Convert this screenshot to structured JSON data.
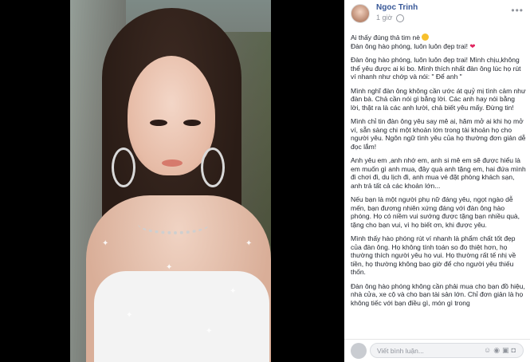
{
  "author": {
    "name": "Ngoc Trinh",
    "meta": "1 giờ"
  },
  "post": {
    "line1": "Ai thấy đúng thả tim nè",
    "line2": "Đàn ông hào phóng, luôn luôn đẹp trai!",
    "paragraphs": [
      "Đàn ông hào phóng, luôn luôn đẹp trai! Mình chịu,không thể yêu được ai ki bo. Mình thích nhất đàn ông lúc họ rút ví nhanh như chớp và nói: \" Để anh \"",
      "Mình nghĩ đàn ông không cần ước át quỷ mị tình cảm như đàn bà. Chả cần nói gì bằng lời. Các anh hay nói bằng lời, thật ra là các anh lười, chả biết yêu mấy. Đừng tin!",
      "Mình chỉ tin đàn ông yêu say mê ai, hăm mở ai khi họ mở ví, sẵn sàng chi một khoản lớn trong tài khoản họ cho người yêu. Ngôn ngữ tình yêu của họ thường đơn giản dễ đọc lắm!",
      "Anh yêu em ,anh nhớ em, anh si mê em sẽ được hiểu là em muốn gì anh mua, đây quà anh tặng em, hai đứa mình đi chơi đi, du lịch đi, anh mua vé đặt phòng khách sạn, anh trả tất cả các khoản lớn...",
      "Nếu bạn là một người phụ nữ đáng yêu, ngọt ngào dễ mến, bạn đương nhiên xứng đáng với đàn ông hào phóng. Họ có niềm vui sướng được tặng bạn nhiều quà, tặng cho bạn vui, vì họ biết ơn, khi được yêu.",
      "Mình thấy hào phóng rút ví nhanh là phẩm chất tốt đẹp của đàn ông. Họ không tính toán so đo thiệt hơn, họ thường thích người yêu họ vui. Họ thường rất tế nhị về tiền, họ thường không bao giờ để cho người yêu thiếu thốn.",
      "Đàn ông hào phóng không cần phải mua cho bạn đồ hiệu, nhà cửa, xe cộ và cho bạn tài sản lớn. Chỉ đơn giản là họ không tiếc với bạn điều gì, món gì trong"
    ]
  },
  "comment": {
    "placeholder": "Viết bình luận...",
    "icons": [
      "emoji-icon",
      "camera-icon",
      "gif-icon",
      "sticker-icon"
    ]
  },
  "colors": {
    "author": "#385898",
    "text": "#1d2129",
    "muted": "#90949c"
  }
}
